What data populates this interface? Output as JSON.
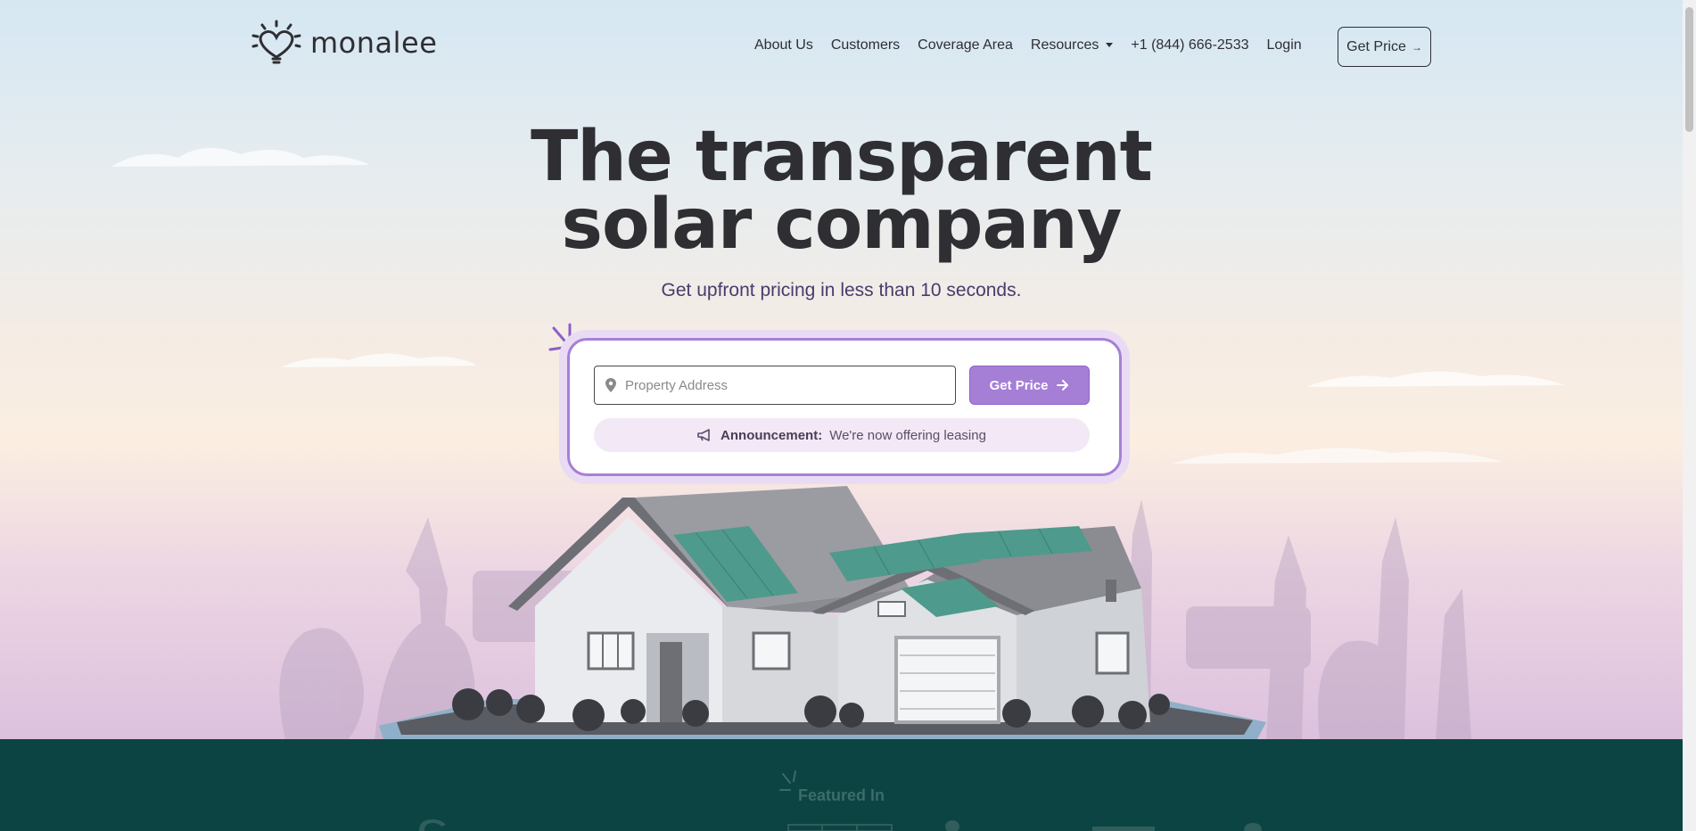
{
  "brand": {
    "name": "monalee"
  },
  "nav": {
    "items": [
      "About Us",
      "Customers",
      "Coverage Area",
      "Resources",
      "+1 (844) 666-2533",
      "Login"
    ],
    "cta_label": "Get Price",
    "cta_arrow": "→"
  },
  "hero": {
    "title_line1": "The transparent",
    "title_line2": "solar company",
    "subtitle": "Get upfront pricing in less than 10 seconds."
  },
  "search": {
    "placeholder": "Property Address",
    "button_label": "Get Price"
  },
  "announcement": {
    "label": "Announcement:",
    "text": "We're now offering leasing"
  },
  "featured": {
    "heading": "Featured In"
  },
  "colors": {
    "accent": "#a57ed6",
    "text_dark": "#2e2e33",
    "footer_bg": "#0c4443"
  },
  "icons": [
    "logo-lightbulb-heart-icon",
    "caret-down-icon",
    "arrow-right-icon",
    "map-pin-icon",
    "megaphone-icon",
    "sparkle-icon"
  ]
}
